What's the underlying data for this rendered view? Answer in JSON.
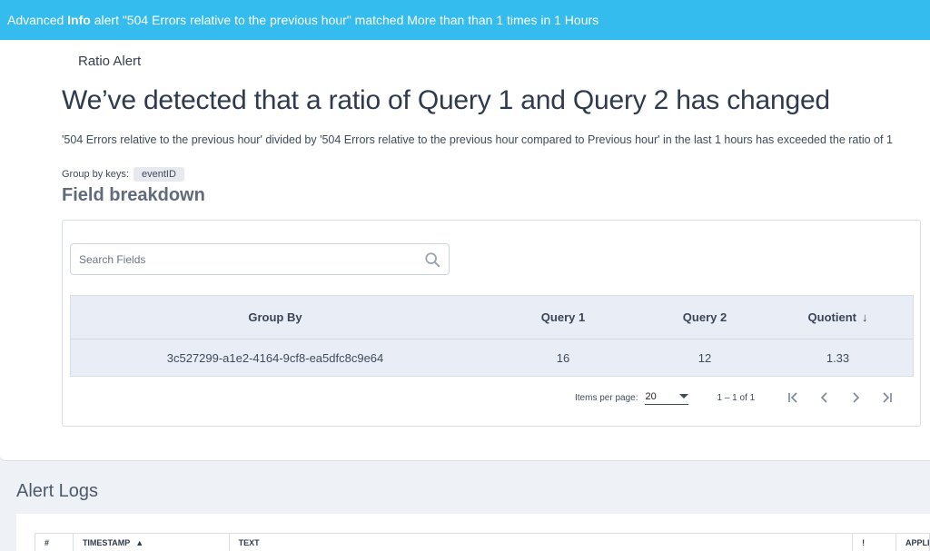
{
  "banner": {
    "prefix": "Advanced ",
    "severity": "Info",
    "suffix": " alert \"504 Errors relative to the previous hour\" matched More than than 1 times in 1 Hours"
  },
  "card": {
    "eyebrow": "Ratio Alert",
    "headline": "We’ve detected that a ratio of Query 1 and Query 2 has changed",
    "description": "'504 Errors relative to the previous hour' divided by '504 Errors relative to the previous hour compared to Previous hour' in the last 1 hours has exceeded the ratio of 1",
    "group_by_label": "Group by keys:",
    "group_by_key": "eventID",
    "section_title": "Field breakdown"
  },
  "search": {
    "placeholder": "Search Fields",
    "value": ""
  },
  "table": {
    "columns": [
      "Group By",
      "Query 1",
      "Query 2",
      "Quotient"
    ],
    "sort_indicator": "↓",
    "rows": [
      [
        "3c527299-a1e2-4164-9cf8-ea5dfc8c9e64",
        "16",
        "12",
        "1.33"
      ]
    ]
  },
  "pagination": {
    "items_per_page_label": "Items per page:",
    "items_per_page": "20",
    "range": "1 – 1 of 1"
  },
  "logs": {
    "title": "Alert Logs",
    "columns": [
      "#",
      "TIMESTAMP",
      "TEXT",
      "!",
      "APPLI"
    ],
    "sort_indicator": "▲"
  },
  "colors": {
    "banner": "#34bcef",
    "table_header": "#e9eef6",
    "page_bg": "#eef1f5"
  }
}
